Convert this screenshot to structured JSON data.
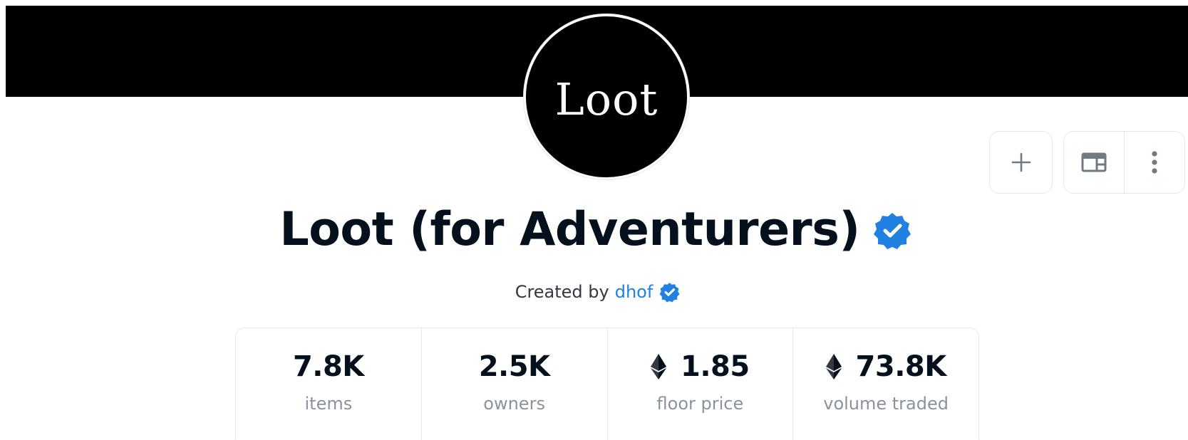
{
  "banner": {
    "color": "#000000"
  },
  "logo": {
    "text": "Loot"
  },
  "actions": {
    "add_icon": "plus-icon",
    "layout_icon": "layout-icon",
    "more_icon": "more-vertical-icon"
  },
  "collection": {
    "name": "Loot (for Adventurers)",
    "verified": true,
    "creator_prefix": "Created by",
    "creator_name": "dhof",
    "creator_verified": true
  },
  "stats": [
    {
      "value": "7.8K",
      "label": "items",
      "eth": false
    },
    {
      "value": "2.5K",
      "label": "owners",
      "eth": false
    },
    {
      "value": "1.85",
      "label": "floor price",
      "eth": true
    },
    {
      "value": "73.8K",
      "label": "volume traded",
      "eth": true
    }
  ],
  "colors": {
    "accent": "#2081e2",
    "text_primary": "#04111d",
    "text_secondary": "#8a939b",
    "border": "#e5e8eb"
  }
}
